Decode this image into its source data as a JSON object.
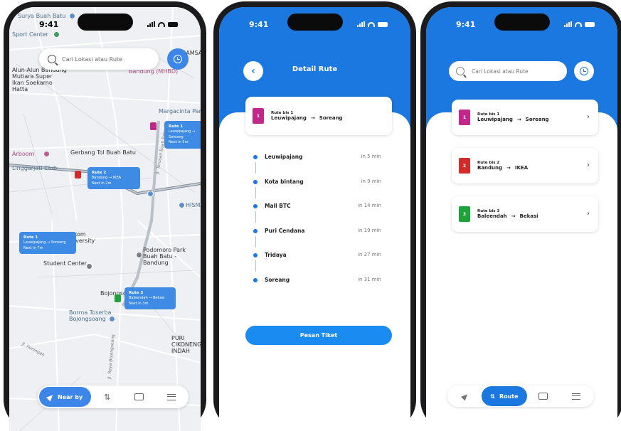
{
  "status": {
    "time": "9:41"
  },
  "screen_map": {
    "search": {
      "placeholder": "Cari Lokasi atau Rute"
    },
    "places": [
      "Surya Buah Batu",
      "Sport Center",
      "Alun-Alun Bandung",
      "Mutiara Super Ikan Soekarno Hatta",
      "SAMSAT",
      "Bandung (MHBD)",
      "Margacinta Park",
      "Gerbang Tol Buah Batu",
      "Arboom",
      "Linggarjati Club",
      "HISMART",
      "Telkom University",
      "Podomoro Park Buah Batu - Bandung",
      "Student Center",
      "Bojongsoang",
      "Borma Toserba Bojongsoang",
      "PURI CIKONENG INDAH",
      "Jl. Kuningan",
      "Jl. Terusan Buah Batu",
      "Jl. Raya Bojongsoang"
    ],
    "route_cards": [
      {
        "title": "Rute 1",
        "from": "Leuwipajang",
        "to": "Soreang",
        "next": "Next in 5m"
      },
      {
        "title": "Rute 2",
        "from": "Bandung",
        "to": "IKEA",
        "next": "Next in 2m"
      },
      {
        "title": "Rute 1",
        "from": "Leuwipajang",
        "to": "Soreang",
        "next": "Next in 7m"
      },
      {
        "title": "Rute 3",
        "from": "Baleendah",
        "to": "Bekasi",
        "next": "Next in 3m"
      }
    ],
    "bus_badges": [
      "1",
      "2"
    ],
    "nav": {
      "active_label": "Near by"
    }
  },
  "screen_detail": {
    "title": "Detail Rute",
    "route": {
      "badge": "1",
      "label": "Rute bis 1",
      "from": "Leuwipajang",
      "to": "Soreang",
      "color": "#c2278a"
    },
    "stops": [
      {
        "name": "Leuwipajang",
        "eta": "in 5 min"
      },
      {
        "name": "Kota bintang",
        "eta": "in 9 min"
      },
      {
        "name": "Mall BTC",
        "eta": "in 14 min"
      },
      {
        "name": "Puri Cendana",
        "eta": "in 19 min"
      },
      {
        "name": "Tridaya",
        "eta": "in 27 min"
      },
      {
        "name": "Soreang",
        "eta": "in 31 min"
      }
    ],
    "cta": "Pesan Tiket"
  },
  "screen_list": {
    "search": {
      "placeholder": "Cari Lokasi atau Rute"
    },
    "routes": [
      {
        "badge": "1",
        "label": "Rute bis 1",
        "from": "Leuwipajang",
        "to": "Soreang",
        "color": "#c2278a"
      },
      {
        "badge": "2",
        "label": "Rute bis 2",
        "from": "Bandung",
        "to": "IKEA",
        "color": "#d32a2a"
      },
      {
        "badge": "3",
        "label": "Rute bis 3",
        "from": "Baleendah",
        "to": "Bekasi",
        "color": "#1ea33a"
      }
    ],
    "nav": {
      "active_label": "Route"
    }
  },
  "colors": {
    "primary": "#1a78e0",
    "map_button": "#3b86e8"
  }
}
